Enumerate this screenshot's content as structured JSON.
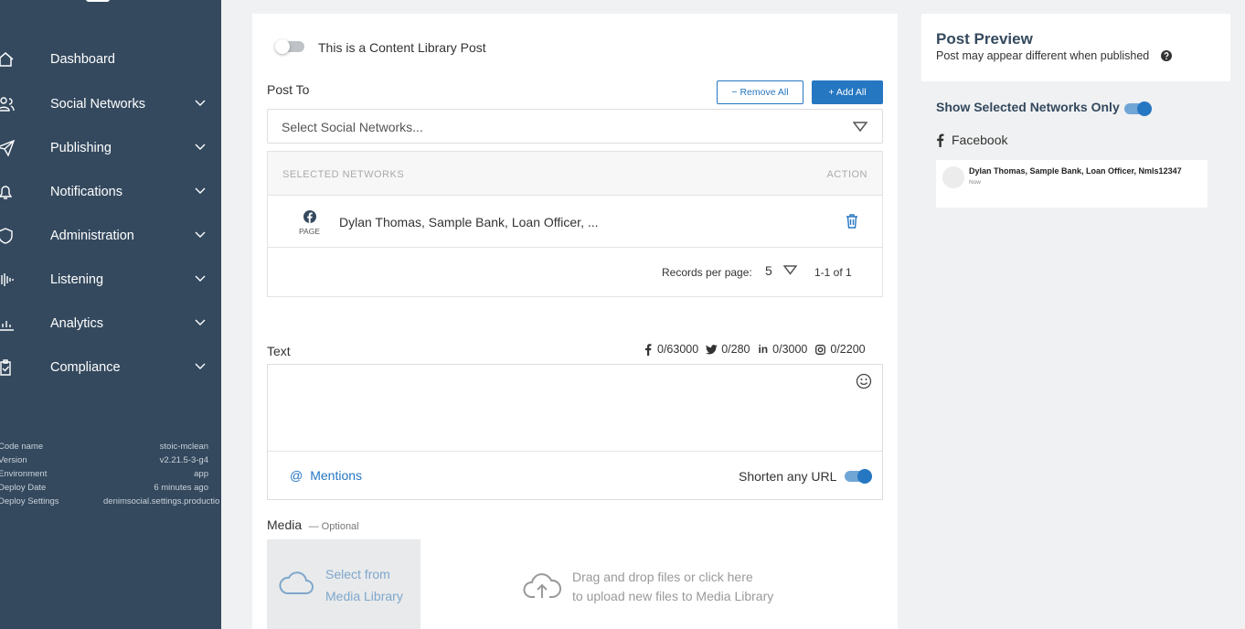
{
  "sidebar": {
    "items": [
      {
        "label": "Dashboard",
        "icon": "home-icon",
        "has_chevron": false
      },
      {
        "label": "Social Networks",
        "icon": "users-icon",
        "has_chevron": true
      },
      {
        "label": "Publishing",
        "icon": "paper-plane-icon",
        "has_chevron": true
      },
      {
        "label": "Notifications",
        "icon": "bell-icon",
        "has_chevron": true
      },
      {
        "label": "Administration",
        "icon": "shield-icon",
        "has_chevron": true
      },
      {
        "label": "Listening",
        "icon": "waveform-icon",
        "has_chevron": true
      },
      {
        "label": "Analytics",
        "icon": "bar-chart-icon",
        "has_chevron": true
      },
      {
        "label": "Compliance",
        "icon": "clipboard-check-icon",
        "has_chevron": true
      }
    ],
    "meta": [
      {
        "key": "Code name",
        "value": "stoic-mclean"
      },
      {
        "key": "Version",
        "value": "v2.21.5-3-g4"
      },
      {
        "key": "Environment",
        "value": "app"
      },
      {
        "key": "Deploy Date",
        "value": "6 minutes ago"
      },
      {
        "key": "Deploy Settings",
        "value": "denimsocial.settings.productio"
      }
    ]
  },
  "composer": {
    "content_library_label": "This is a Content Library Post",
    "content_library_on": false,
    "post_to_label": "Post To",
    "remove_all_label": "− Remove All",
    "add_all_label": "+ Add All",
    "select_placeholder": "Select Social Networks...",
    "networks_table": {
      "header_selected": "SELECTED NETWORKS",
      "header_action": "ACTION",
      "rows": [
        {
          "network": "Facebook",
          "type": "PAGE",
          "name": "Dylan Thomas, Sample Bank, Loan Officer, ..."
        }
      ],
      "records_per_page_label": "Records per page:",
      "records_per_page": "5",
      "range": "1-1 of 1"
    },
    "text_label": "Text",
    "counts": {
      "facebook": "0/63000",
      "twitter": "0/280",
      "linkedin": "0/3000",
      "instagram": "0/2200"
    },
    "mentions_label": "Mentions",
    "shorten_url_label": "Shorten any URL",
    "shorten_url_on": true,
    "media_label": "Media",
    "media_optional": "— Optional",
    "select_media_line1": "Select from",
    "select_media_line2": "Media Library",
    "drop_line1": "Drag and drop files or click here",
    "drop_line2": "to upload new files to Media Library"
  },
  "preview": {
    "title": "Post Preview",
    "subtitle": "Post may appear different when published",
    "show_selected_label": "Show Selected Networks Only",
    "show_selected_on": true,
    "network_label": "Facebook",
    "card_name": "Dylan Thomas, Sample Bank, Loan Officer, Nmls12347",
    "card_time": "Now"
  },
  "colors": {
    "sidebar": "#34495e",
    "accent": "#2677c2"
  }
}
